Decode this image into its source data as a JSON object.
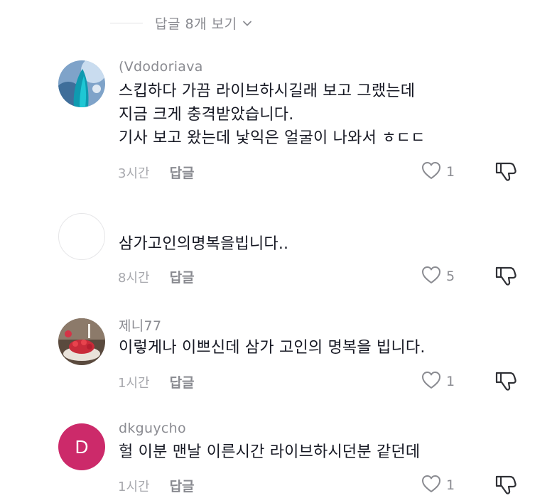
{
  "view_replies": {
    "label": "답글 8개 보기",
    "icon": "chevron-down-icon"
  },
  "comments": [
    {
      "username": "(Vdodoriava",
      "lines": [
        "스킵하다 가끔 라이브하시길래 보고 그랬는데",
        "지금 크게 충격받았습니다.",
        "기사 보고 왔는데 낯익은 얼굴이 나와서 ㅎㄷㄷ"
      ],
      "time": "3시간",
      "reply": "답글",
      "likes": "1"
    },
    {
      "username": "",
      "lines": [
        "삼가고인의명복을빕니다.."
      ],
      "time": "8시간",
      "reply": "답글",
      "likes": "5"
    },
    {
      "username": "제니77",
      "lines": [
        "이렇게나 이쁘신데 삼가 고인의 명복을 빕니다."
      ],
      "time": "1시간",
      "reply": "답글",
      "likes": "1"
    },
    {
      "username": "dkguycho",
      "avatar_letter": "D",
      "avatar_color": "#cc2a6a",
      "lines": [
        "헐 이분 맨날 이른시간 라이브하시던분 같던데"
      ],
      "time": "1시간",
      "reply": "답글",
      "likes": "1"
    }
  ]
}
